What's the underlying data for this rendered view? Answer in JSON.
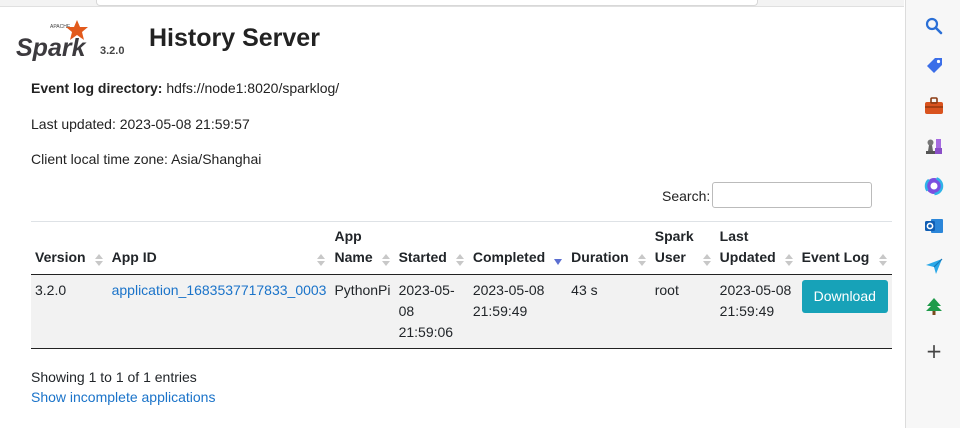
{
  "header": {
    "title": "History Server",
    "spark_version": "3.2.0",
    "logo_text": "Spark",
    "logo_sub": "APACHE"
  },
  "info": {
    "event_log_label": "Event log directory:",
    "event_log_value": "hdfs://node1:8020/sparklog/",
    "last_updated": "Last updated: 2023-05-08 21:59:57",
    "timezone": "Client local time zone: Asia/Shanghai"
  },
  "search": {
    "label": "Search:",
    "value": ""
  },
  "table": {
    "columns": [
      "Version",
      "App ID",
      "App Name",
      "Started",
      "Completed",
      "Duration",
      "Spark User",
      "Last Updated",
      "Event Log"
    ],
    "sorted_column": "Completed",
    "rows": [
      {
        "version": "3.2.0",
        "app_id": "application_1683537717833_0003",
        "app_name": "PythonPi",
        "started": "2023-05-08 21:59:06",
        "completed": "2023-05-08 21:59:49",
        "duration": "43 s",
        "spark_user": "root",
        "last_updated": "2023-05-08 21:59:49",
        "event_log": "Download"
      }
    ]
  },
  "footer": {
    "showing": "Showing 1 to 1 of 1 entries",
    "incomplete_link": "Show incomplete applications"
  },
  "colors": {
    "link": "#1a73c9",
    "download_button": "#17a2b8",
    "spark_orange": "#e25a1c"
  },
  "sidebar_icons": [
    "search-icon",
    "tag-icon",
    "briefcase-icon",
    "chess-icon",
    "copilot-icon",
    "outlook-icon",
    "send-icon",
    "tree-icon",
    "plus-icon"
  ]
}
